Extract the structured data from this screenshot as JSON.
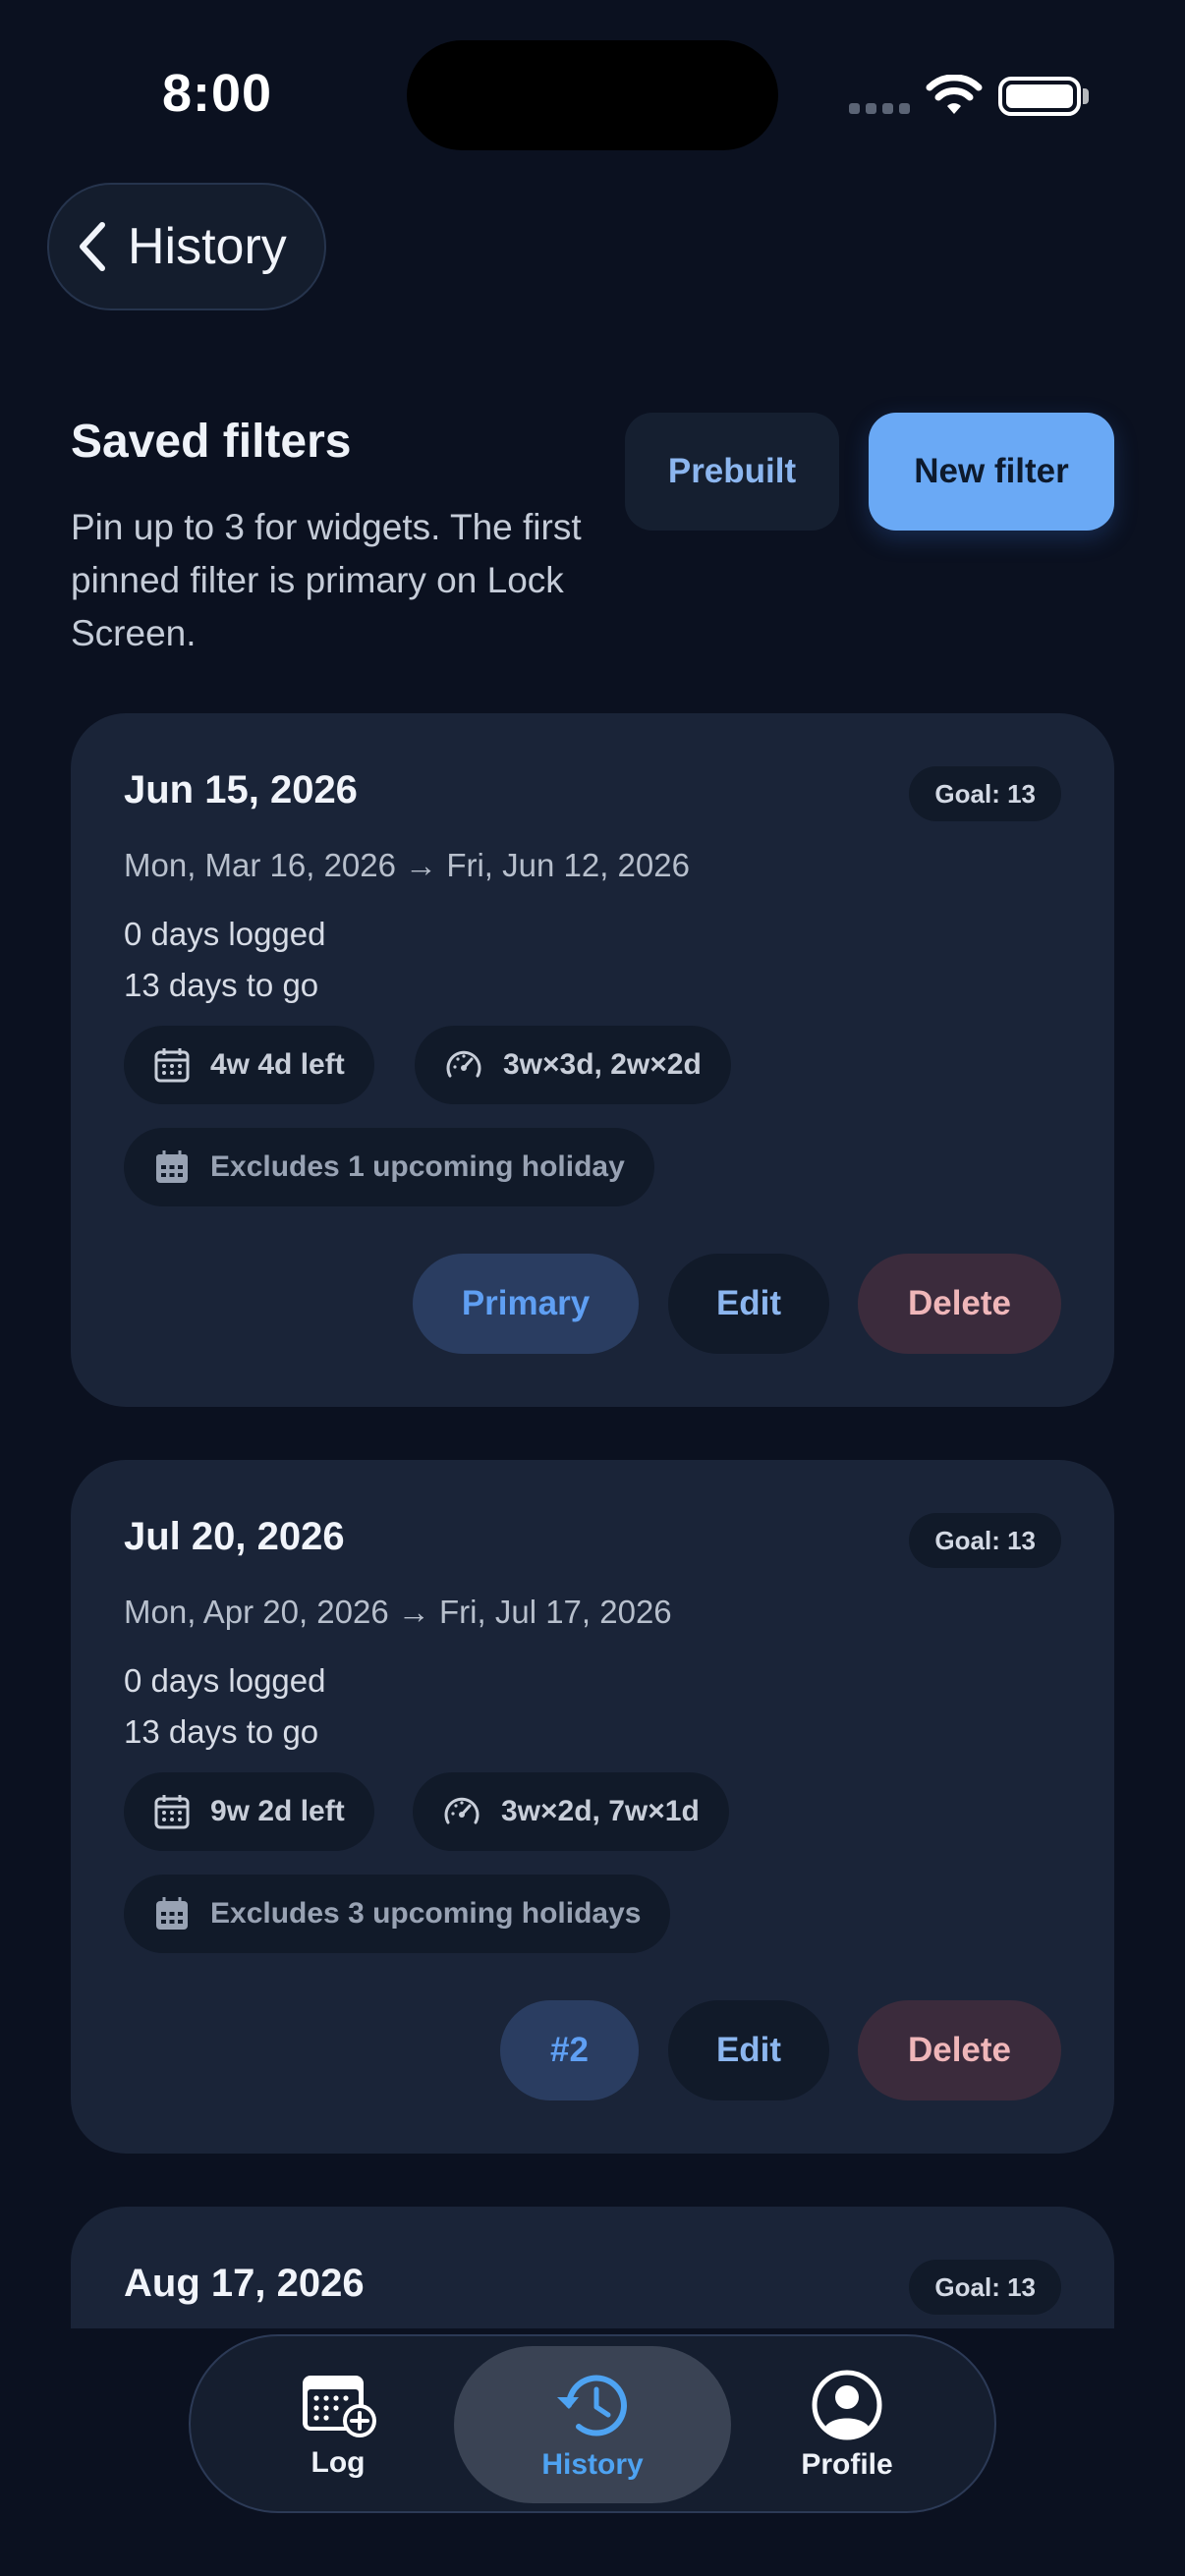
{
  "status_bar": {
    "time": "8:00"
  },
  "header": {
    "back_label": "History"
  },
  "saved_filters": {
    "title": "Saved filters",
    "description": "Pin up to 3 for widgets. The first pinned filter is primary on Lock Screen.",
    "prebuilt_label": "Prebuilt",
    "new_filter_label": "New filter"
  },
  "cards": [
    {
      "title": "Jun 15, 2026",
      "goal": "Goal: 13",
      "range": "Mon, Mar 16, 2026 → Fri, Jun 12, 2026",
      "logged": "0 days logged",
      "to_go": "13 days to go",
      "time_left": "4w 4d left",
      "pace": "3w×3d, 2w×2d",
      "holidays": "Excludes 1 upcoming holiday",
      "pin_label": "Primary",
      "edit_label": "Edit",
      "delete_label": "Delete"
    },
    {
      "title": "Jul 20, 2026",
      "goal": "Goal: 13",
      "range": "Mon, Apr 20, 2026 → Fri, Jul 17, 2026",
      "logged": "0 days logged",
      "to_go": "13 days to go",
      "time_left": "9w 2d left",
      "pace": "3w×2d, 7w×1d",
      "holidays": "Excludes 3 upcoming holidays",
      "pin_label": "#2",
      "edit_label": "Edit",
      "delete_label": "Delete"
    },
    {
      "title": "Aug 17, 2026",
      "goal": "Goal: 13"
    }
  ],
  "bottom_nav": {
    "items": [
      {
        "label": "Log",
        "icon": "calendar-plus-icon"
      },
      {
        "label": "History",
        "icon": "history-clock-icon",
        "active": true
      },
      {
        "label": "Profile",
        "icon": "profile-icon"
      }
    ]
  },
  "colors": {
    "background": "#0b1120",
    "card": "#1a2438",
    "accent": "#6aa9f5",
    "active_nav": "#4ea3f2",
    "delete_text": "#efb6b9"
  }
}
